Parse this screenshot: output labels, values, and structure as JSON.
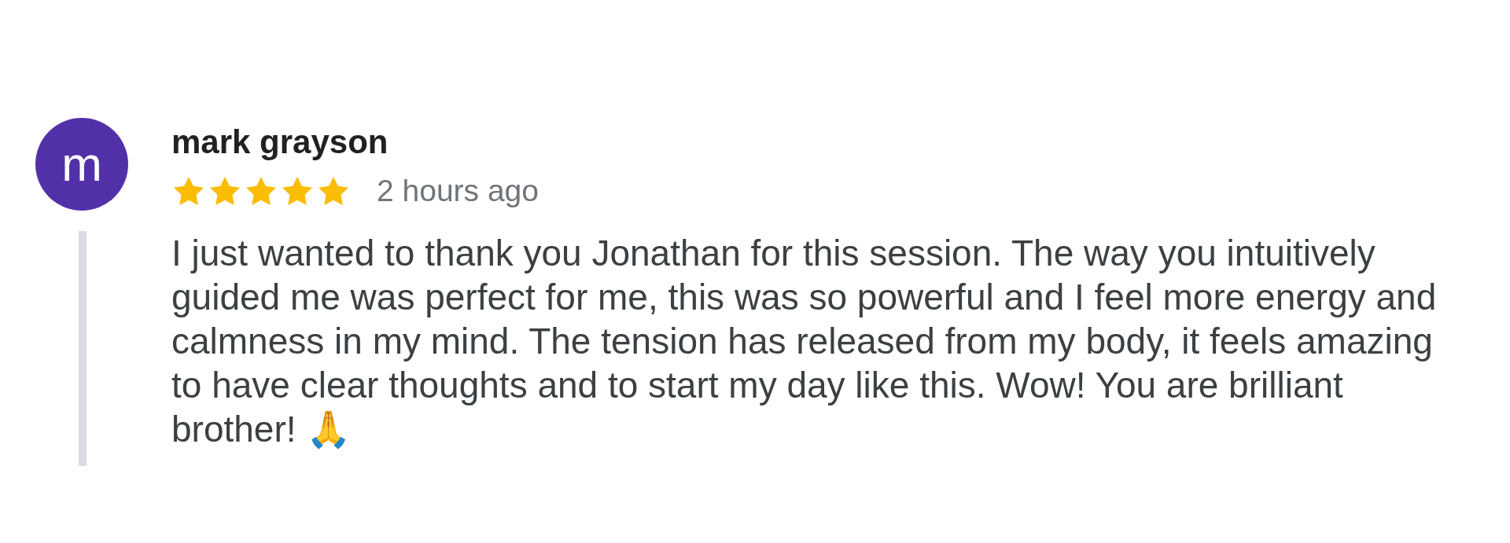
{
  "review": {
    "avatar": {
      "initial": "m"
    },
    "author": "mark grayson",
    "stars": 5,
    "time": "2 hours ago",
    "text": "I just wanted to thank you Jonathan for this session. The way you intuitively guided me was perfect for me, this was so powerful and I feel more energy and calmness in my mind. The tension has released from my body, it feels amazing to have clear thoughts and to start my day like this. Wow! You are brilliant brother! 🙏"
  }
}
